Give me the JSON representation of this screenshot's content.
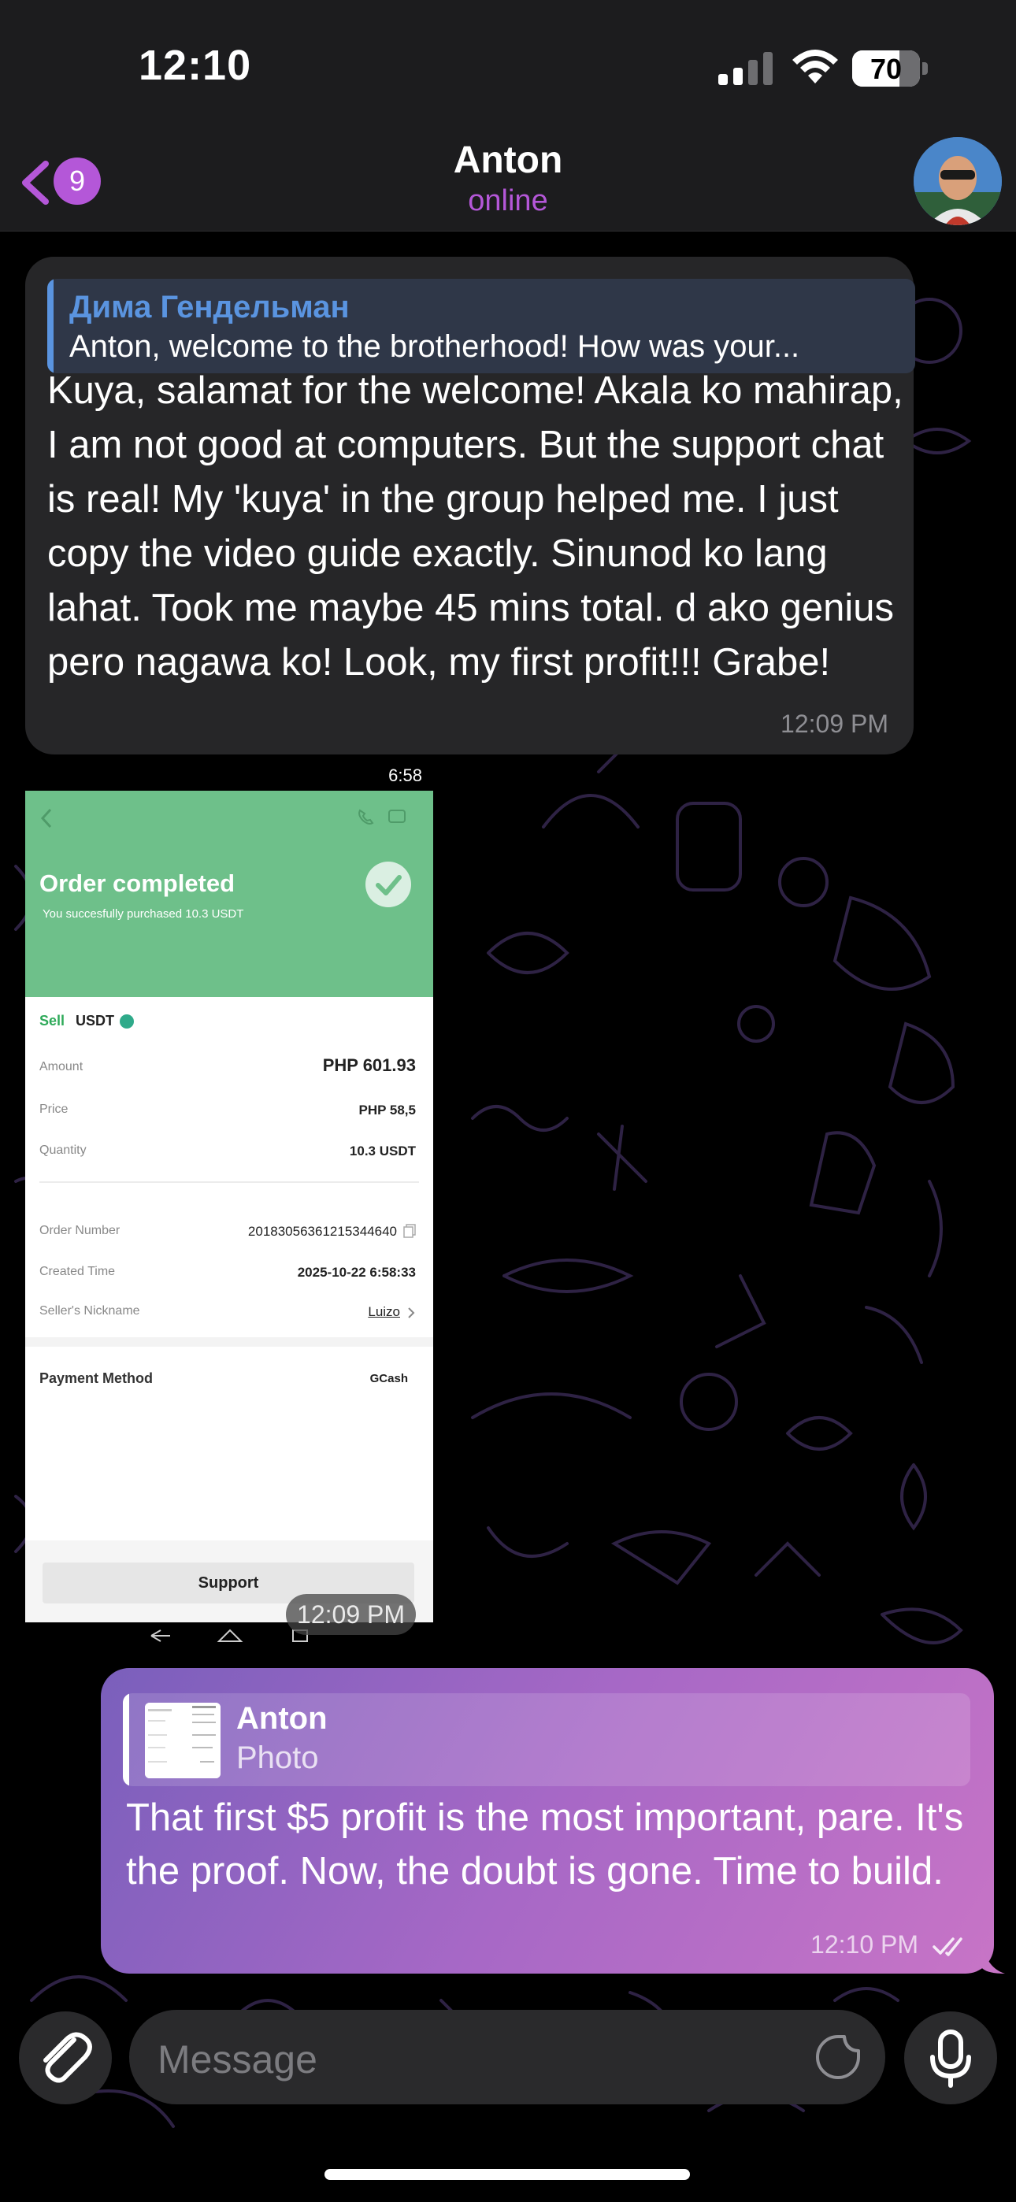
{
  "status_bar": {
    "time": "12:10",
    "battery": "70",
    "battery_level": 0.7
  },
  "header": {
    "back_badge": "9",
    "title": "Anton",
    "status": "online"
  },
  "messages": {
    "incoming": {
      "reply_author": "Дима Гендельман",
      "reply_text": "Anton, welcome to the brotherhood! How was your...",
      "text": "Kuya, salamat for the welcome! Akala ko mahirap, I am not good at computers. But the support chat is real! My 'kuya' in the group helped me. I just copy the video guide exactly. Sinunod ko lang lahat. Took me maybe 45 mins total. d ako genius pero nagawa ko! Look, my first profit!!! Grabe!",
      "time": "12:09 PM"
    },
    "photo": {
      "status_time": "6:58",
      "title": "Order completed",
      "subtitle": "You succesfully purchased 10.3 USDT",
      "side": "Sell",
      "asset": "USDT",
      "rows": [
        {
          "label": "Amount",
          "value": "PHP 601.93"
        },
        {
          "label": "Price",
          "value": "PHP 58,5"
        },
        {
          "label": "Quantity",
          "value": "10.3 USDT"
        },
        {
          "label": "Order Number",
          "value": "20183056361215344640"
        },
        {
          "label": "Created Time",
          "value": "2025-10-22 6:58:33"
        },
        {
          "label": "Seller's Nickname",
          "value": "Luizo"
        },
        {
          "label": "Payment Method",
          "value": "GCash"
        }
      ],
      "support_label": "Support",
      "time": "12:09 PM"
    },
    "outgoing": {
      "reply_author": "Anton",
      "reply_text": "Photo",
      "text": "That first $5 profit is the most important, pare. It's the proof. Now, the doubt is gone. Time to build.",
      "time": "12:10 PM"
    }
  },
  "input": {
    "placeholder": "Message"
  },
  "colors": {
    "accent": "#b457d8",
    "incoming_bubble": "#262628",
    "outgoing_bubble_start": "#7a5fbc",
    "outgoing_bubble_end": "#c774c6",
    "reply_name": "#5a94e0"
  }
}
